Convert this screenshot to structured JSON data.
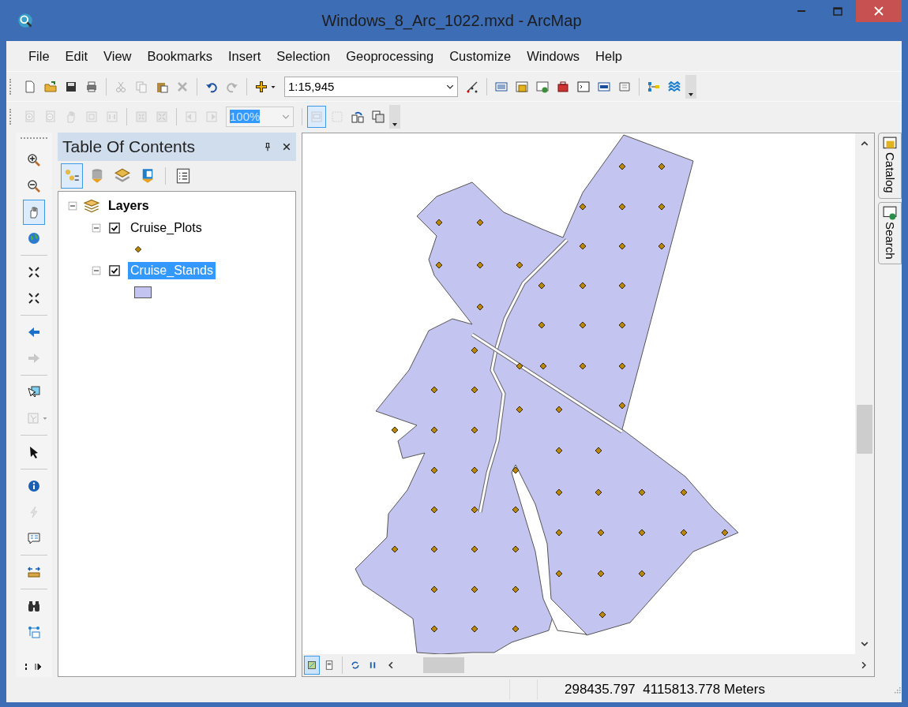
{
  "window": {
    "title": "Windows_8_Arc_1022.mxd - ArcMap"
  },
  "menu": [
    "File",
    "Edit",
    "View",
    "Bookmarks",
    "Insert",
    "Selection",
    "Geoprocessing",
    "Customize",
    "Windows",
    "Help"
  ],
  "standard_toolbar": {
    "items": [
      {
        "disabled": false
      },
      {
        "disabled": false
      },
      {
        "disabled": false
      },
      {
        "disabled": false
      },
      {
        "disabled": true
      },
      {
        "disabled": true
      },
      {
        "disabled": false
      },
      {
        "disabled": true
      },
      {
        "disabled": false
      },
      {
        "disabled": true
      },
      {
        "disabled": false
      }
    ],
    "scale": {
      "value": "1:15,945"
    },
    "tools": [
      {
        "disabled": false
      },
      {
        "disabled": false
      },
      {
        "disabled": false
      },
      {
        "disabled": false
      },
      {
        "disabled": false
      },
      {
        "disabled": false
      },
      {
        "disabled": false
      },
      {
        "disabled": false
      },
      {
        "disabled": false
      },
      {
        "disabled": false
      }
    ]
  },
  "layout_toolbar": {
    "items": [
      {
        "disabled": true
      },
      {
        "disabled": true
      },
      {
        "disabled": true
      },
      {
        "disabled": true
      },
      {
        "disabled": true
      },
      {
        "disabled": true
      },
      {
        "disabled": true
      },
      {
        "disabled": true
      },
      {
        "disabled": true
      }
    ],
    "zoom": {
      "value": "100%",
      "disabled": true
    },
    "tools": [
      {
        "disabled": true,
        "selected": true
      },
      {
        "disabled": true,
        "selected": false
      },
      {
        "disabled": false,
        "selected": false
      },
      {
        "disabled": false,
        "selected": false
      }
    ]
  },
  "tools_toolbar": [
    {
      "disabled": false,
      "selected": false
    },
    {
      "disabled": false,
      "selected": false
    },
    {
      "disabled": false,
      "selected": true
    },
    {
      "disabled": false,
      "selected": false
    },
    {
      "disabled": false,
      "selected": false
    },
    {
      "disabled": false,
      "selected": false
    },
    {
      "disabled": false,
      "selected": false
    },
    {
      "disabled": true,
      "selected": false
    },
    {
      "disabled": false,
      "selected": false
    },
    {
      "disabled": true,
      "selected": false
    },
    {
      "disabled": false,
      "selected": false
    },
    {
      "disabled": false,
      "selected": false
    },
    {
      "disabled": true,
      "selected": false
    },
    {
      "disabled": false,
      "selected": false
    },
    {
      "disabled": false,
      "selected": false
    },
    {
      "disabled": false,
      "selected": false
    },
    {
      "disabled": false,
      "selected": false
    }
  ],
  "toc": {
    "title": "Table Of Contents",
    "views": [
      {
        "selected": true
      },
      {
        "selected": false
      },
      {
        "selected": false
      },
      {
        "selected": false
      },
      {
        "selected": false
      }
    ],
    "tree": {
      "label": "Layers",
      "expanded": true,
      "children": [
        {
          "label": "Cruise_Plots",
          "checked": true,
          "expanded": true,
          "selected": false,
          "kind": "point"
        },
        {
          "label": "Cruise_Stands",
          "checked": true,
          "expanded": true,
          "selected": true,
          "kind": "polygon"
        }
      ]
    }
  },
  "map_views": [
    {
      "selected": true
    },
    {
      "selected": false
    }
  ],
  "dock_tabs": [
    "Catalog",
    "Search"
  ],
  "status_bar": {
    "coordinates": "298435.797  4115813.778 Meters"
  }
}
